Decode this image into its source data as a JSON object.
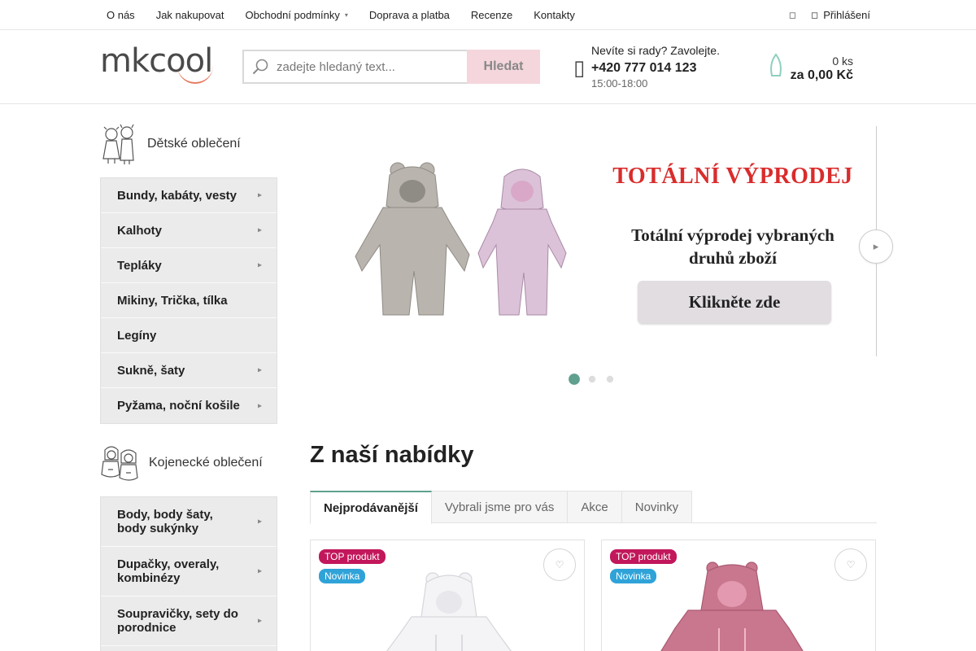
{
  "topnav": {
    "items": [
      {
        "label": "O nás"
      },
      {
        "label": "Jak nakupovat"
      },
      {
        "label": "Obchodní podmínky",
        "has_dropdown": true
      },
      {
        "label": "Doprava a platba"
      },
      {
        "label": "Recenze"
      },
      {
        "label": "Kontakty"
      }
    ],
    "login_label": "Přihlášení"
  },
  "header": {
    "logo_text": "mkcool",
    "search_placeholder": "zadejte hledaný text...",
    "search_button": "Hledat",
    "contact_prompt": "Nevíte si rady? Zavolejte.",
    "contact_phone": "+420 777 014 123",
    "contact_hours": "15:00-18:00",
    "cart_qty": "0 ks",
    "cart_price": "za 0,00 Kč"
  },
  "sidebar": {
    "groups": [
      {
        "title": "Dětské oblečení",
        "items": [
          {
            "label": "Bundy, kabáty, vesty",
            "chevron": true
          },
          {
            "label": "Kalhoty",
            "chevron": true
          },
          {
            "label": "Tepláky",
            "chevron": true
          },
          {
            "label": "Mikiny, Trička, tílka",
            "chevron": false
          },
          {
            "label": "Legíny",
            "chevron": false
          },
          {
            "label": "Sukně, šaty",
            "chevron": true
          },
          {
            "label": "Pyžama, noční košile",
            "chevron": true
          }
        ]
      },
      {
        "title": "Kojenecké oblečení",
        "items": [
          {
            "label": "Body, body šaty, body sukýnky",
            "chevron": true
          },
          {
            "label": "Dupačky, overaly, kombinézy",
            "chevron": true
          },
          {
            "label": "Soupravičky, sety do porodnice",
            "chevron": true
          }
        ]
      }
    ]
  },
  "banner": {
    "title": "TOTÁLNÍ VÝPRODEJ",
    "subtitle_line1": "Totální výprodej vybraných",
    "subtitle_line2": "druhů zboží",
    "cta": "Klikněte zde",
    "slides_total": 3,
    "active_slide": 1,
    "colors": {
      "title": "#d92c2c",
      "dot_active": "#5fa08e"
    }
  },
  "offers": {
    "title": "Z naší nabídky",
    "tabs": [
      {
        "label": "Nejprodávanější",
        "active": true
      },
      {
        "label": "Vybrali jsme pro vás",
        "active": false
      },
      {
        "label": "Akce",
        "active": false
      },
      {
        "label": "Novinky",
        "active": false
      }
    ],
    "products": [
      {
        "badges": [
          "TOP produkt",
          "Novinka"
        ],
        "image": "white-baby-jumpsuit"
      },
      {
        "badges": [
          "TOP produkt",
          "Novinka"
        ],
        "image": "pink-baby-jumpsuit"
      }
    ]
  },
  "icons": {
    "search": "search-icon",
    "phone": "phone-icon",
    "cart": "cart-icon",
    "user": "user-icon",
    "chevron": "chevron-right-icon",
    "heart": "heart-icon"
  }
}
